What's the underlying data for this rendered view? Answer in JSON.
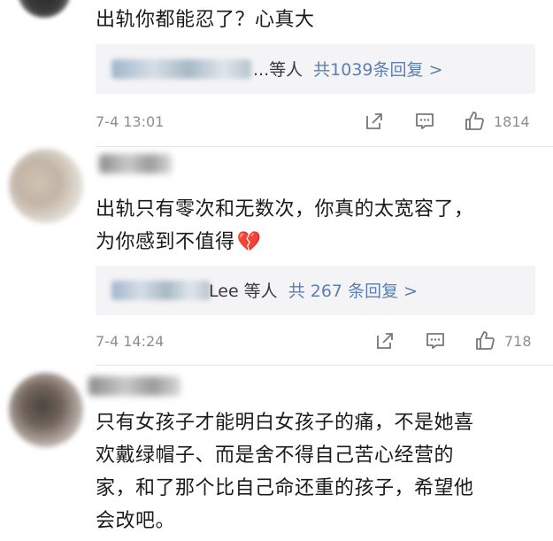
{
  "comments": [
    {
      "text": "出轨你都能忍了？心真大",
      "reply_name_suffix": "...等人",
      "reply_count": "共1039条回复 >",
      "time": "7-4 13:01",
      "likes": "1814"
    },
    {
      "text_line1": "出轨只有零次和无数次，你真的太宽容了，",
      "text_line2": "为你感到不值得",
      "emoji": "💔",
      "reply_name_suffix": "Lee 等人",
      "reply_count": "共 267 条回复 >",
      "time": "7-4 14:24",
      "likes": "718"
    },
    {
      "text_line1": "只有女孩子才能明白女孩子的痛，不是她喜",
      "text_line2": "欢戴绿帽子、而是舍不得自己苦心经营的",
      "text_line3": "家，和了那个比自己命还重的孩子，希望他",
      "text_line4": "会改吧。"
    }
  ],
  "icons": {
    "share": "share-icon",
    "comment": "comment-icon",
    "like": "like-icon"
  },
  "colors": {
    "link_blue": "#5b7fb0",
    "reply_bg": "#f4f4f6",
    "meta_gray": "#8d8d8d"
  }
}
